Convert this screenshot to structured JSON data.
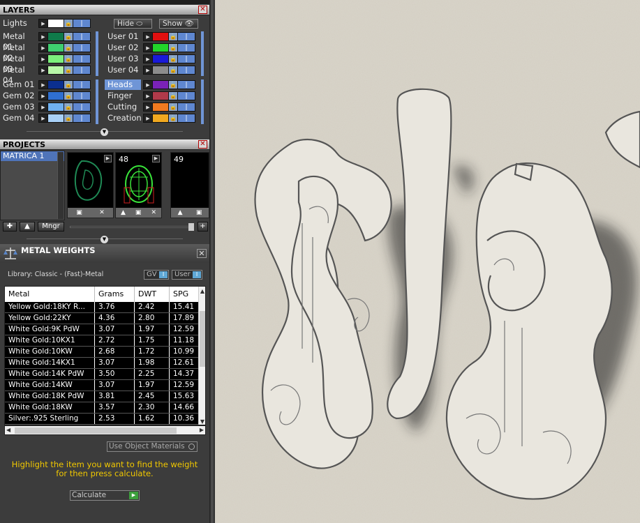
{
  "layers": {
    "title": "LAYERS",
    "lights_label": "Lights",
    "hide_label": "Hide",
    "show_label": "Show",
    "left_groups": [
      [
        {
          "name": "Metal 01",
          "color": "#0f7a4a"
        },
        {
          "name": "Metal 02",
          "color": "#3fcf6f"
        },
        {
          "name": "Metal 03",
          "color": "#7cf07c"
        },
        {
          "name": "Metal 04",
          "color": "#b8f7a8"
        }
      ],
      [
        {
          "name": "Gem 01",
          "color": "#0b2f8f"
        },
        {
          "name": "Gem 02",
          "color": "#2f6fd0"
        },
        {
          "name": "Gem 03",
          "color": "#6fb0f0"
        },
        {
          "name": "Gem 04",
          "color": "#a8d0f7"
        }
      ]
    ],
    "right_groups": [
      [
        {
          "name": "User 01",
          "color": "#e01010"
        },
        {
          "name": "User 02",
          "color": "#22d42a"
        },
        {
          "name": "User 03",
          "color": "#1a1ad8"
        },
        {
          "name": "User 04",
          "color": "#8c8c8c"
        }
      ],
      [
        {
          "name": "Heads",
          "color": "#7a22b8",
          "selected": true
        },
        {
          "name": "Finger",
          "color": "#b03a4a"
        },
        {
          "name": "Cutting",
          "color": "#f07a20"
        },
        {
          "name": "Creation",
          "color": "#f0a820"
        }
      ]
    ],
    "lights_color": "#ffffff"
  },
  "projects": {
    "title": "PROJECTS",
    "items": [
      "MATRICA 1"
    ],
    "thumbnails": [
      {
        "number": "",
        "color": "#1f8a55"
      },
      {
        "number": "48",
        "color": "#39e43a"
      },
      {
        "number": "49",
        "color": "#000000"
      }
    ],
    "mngr_label": "Mngr"
  },
  "metal_weights": {
    "title": "METAL WEIGHTS",
    "library": "Library: Classic - (Fast)-Metal",
    "gv_label": "GV",
    "user_label": "User",
    "columns": [
      "Metal",
      "Grams",
      "DWT",
      "SPG"
    ],
    "rows": [
      [
        "Yellow Gold:18KY R...",
        "3.76",
        "2.42",
        "15.41"
      ],
      [
        "Yellow Gold:22KY",
        "4.36",
        "2.80",
        "17.89"
      ],
      [
        "White Gold:9K PdW",
        "3.07",
        "1.97",
        "12.59"
      ],
      [
        "White Gold:10KX1",
        "2.72",
        "1.75",
        "11.18"
      ],
      [
        "White Gold:10KW",
        "2.68",
        "1.72",
        "10.99"
      ],
      [
        "White Gold:14KX1",
        "3.07",
        "1.98",
        "12.61"
      ],
      [
        "White Gold:14K PdW",
        "3.50",
        "2.25",
        "14.37"
      ],
      [
        "White Gold:14KW",
        "3.07",
        "1.97",
        "12.59"
      ],
      [
        "White Gold:18K PdW",
        "3.81",
        "2.45",
        "15.63"
      ],
      [
        "White Gold:18KW",
        "3.57",
        "2.30",
        "14.66"
      ],
      [
        "Silver:.925 Sterling",
        "2.53",
        "1.62",
        "10.36"
      ]
    ],
    "use_object_materials": "Use Object Materials",
    "help_text": "Highlight the item you want to find the weight for then press calculate.",
    "calculate_label": "Calculate"
  }
}
